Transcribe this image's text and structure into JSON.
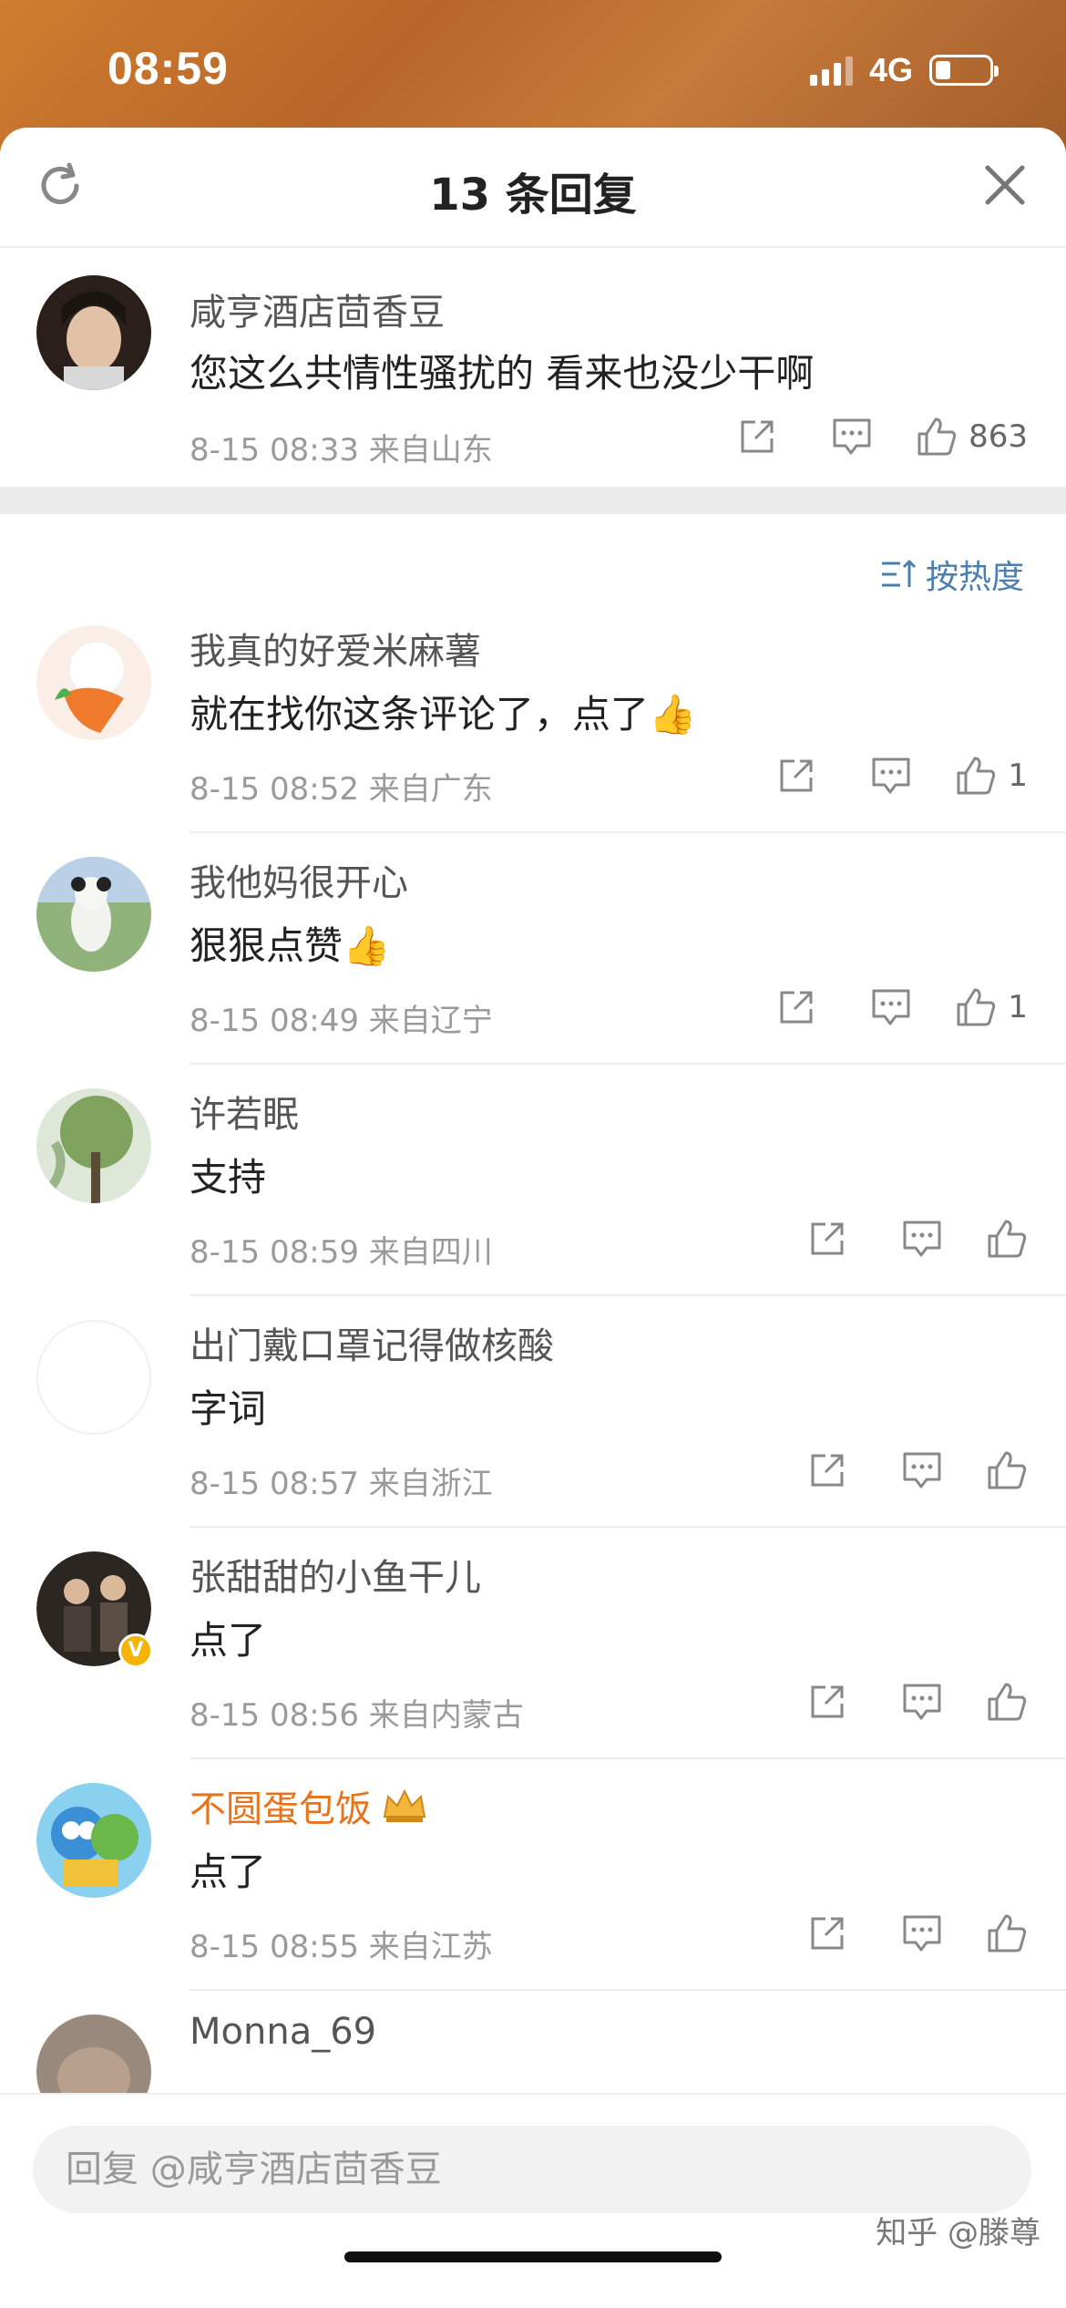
{
  "status_bar": {
    "time": "08:59",
    "network": "4G"
  },
  "header": {
    "title": "13 条回复"
  },
  "main_comment": {
    "author": "咸亨酒店茴香豆",
    "text": "您这么共情性骚扰的 看来也没少干啊",
    "meta": "8-15 08:33  来自山东",
    "likes": "863"
  },
  "sort": {
    "label": "按热度"
  },
  "replies": [
    {
      "author": "我真的好爱米麻薯",
      "text": "就在找你这条评论了，点了👍",
      "meta": "8-15 08:52  来自广东",
      "likes": "1"
    },
    {
      "author": "我他妈很开心",
      "text": "狠狠点赞👍",
      "meta": "8-15 08:49  来自辽宁",
      "likes": "1"
    },
    {
      "author": "许若眠",
      "text": "支持",
      "meta": "8-15 08:59  来自四川",
      "likes": ""
    },
    {
      "author": "出门戴口罩记得做核酸",
      "text": "字词",
      "meta": "8-15 08:57  来自浙江",
      "likes": ""
    },
    {
      "author": "张甜甜的小鱼干儿",
      "text": "点了",
      "meta": "8-15 08:56  来自内蒙古",
      "likes": ""
    },
    {
      "author": "不圆蛋包饭",
      "text": "点了",
      "meta": "8-15 08:55  来自江苏",
      "likes": ""
    },
    {
      "author": "Monna_69",
      "text": "",
      "meta": "",
      "likes": ""
    }
  ],
  "reply_input": {
    "placeholder": "回复 @咸亨酒店茴香豆"
  },
  "watermark": "知乎 @滕尊",
  "colors": {
    "accent": "#4c7fb0",
    "vip_name": "#e8731c",
    "background_top": "#c0712e"
  }
}
